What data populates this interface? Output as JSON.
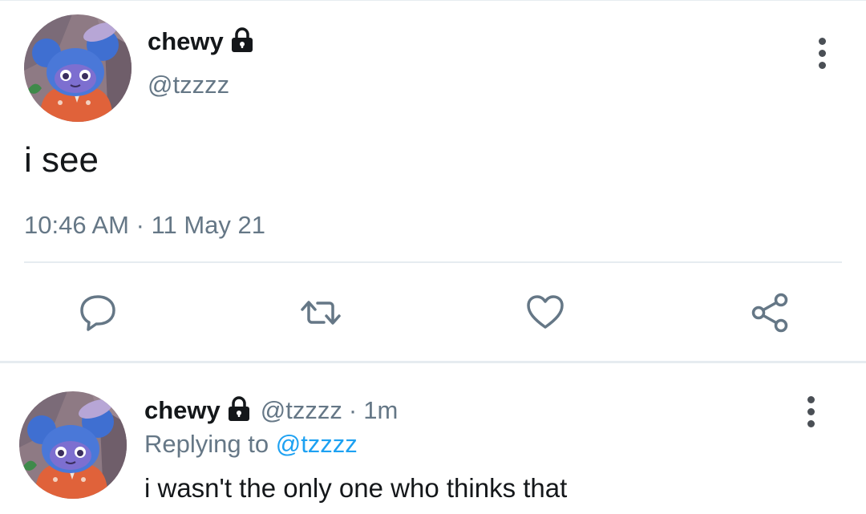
{
  "colors": {
    "text_primary": "#14171a",
    "text_secondary": "#657786",
    "link": "#1da1f2",
    "divider": "#e6ecf0",
    "icon": "#657786"
  },
  "main_tweet": {
    "display_name": "chewy",
    "handle": "@tzzzz",
    "text": "i see",
    "time": "10:46 AM",
    "separator": "·",
    "date": "11 May 21",
    "icons": {
      "lock": "lock-icon",
      "more": "more-vertical-icon",
      "reply": "comment-icon",
      "retweet": "retweet-icon",
      "like": "heart-icon",
      "share": "share-icon"
    }
  },
  "reply_tweet": {
    "display_name": "chewy",
    "handle": "@tzzzz",
    "separator": "·",
    "time_ago": "1m",
    "replying_to_label": "Replying to",
    "replying_to_handle": "@tzzzz",
    "text": "i wasn't the only one who thinks that"
  }
}
